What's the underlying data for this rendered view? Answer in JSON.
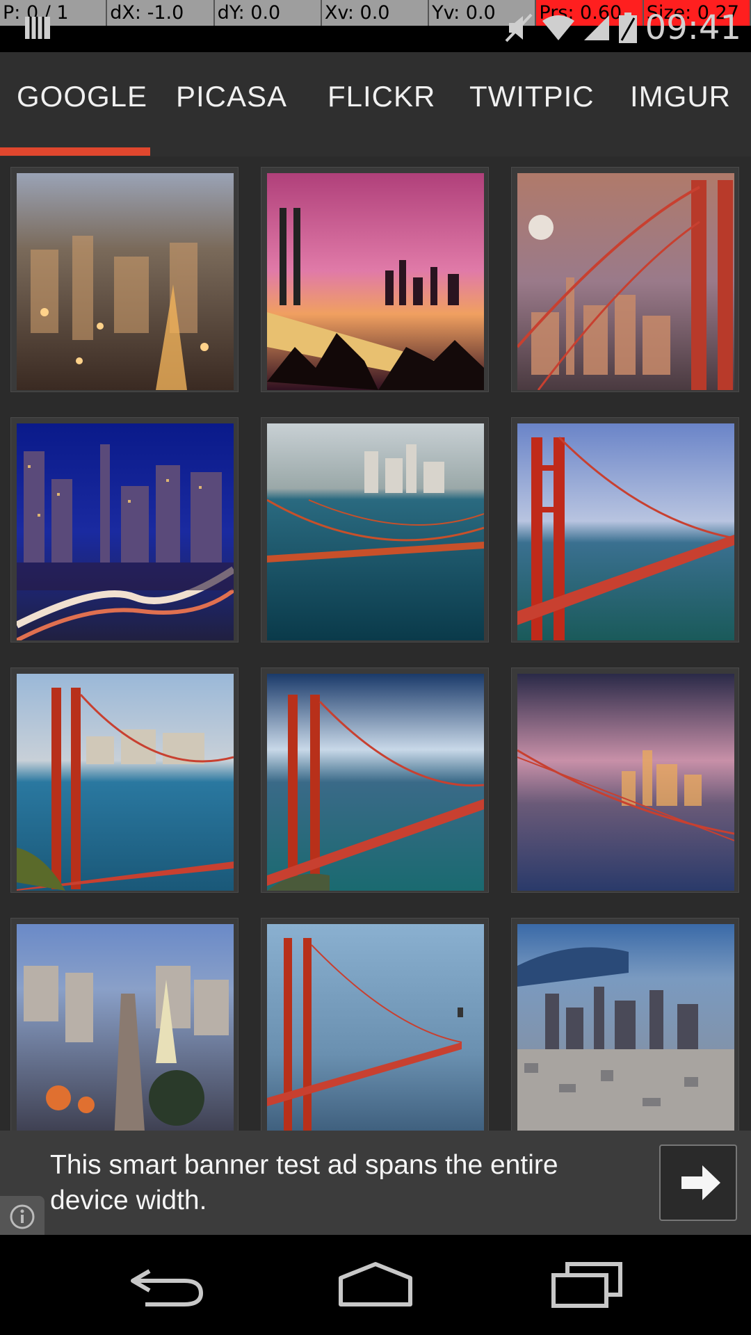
{
  "status": {
    "debug": {
      "p": "P: 0 / 1",
      "dx": "dX: -1.0",
      "dy": "dY: 0.0",
      "xv": "Xv: 0.0",
      "yv": "Yv: 0.0",
      "prs": "Prs: 0.60",
      "size": "Size: 0.27"
    },
    "time": "09:41",
    "icons": [
      "notification-icon",
      "mute-icon",
      "wifi-icon",
      "signal-icon",
      "battery-icon"
    ]
  },
  "tabs": {
    "items": [
      {
        "label": "GOOGLE",
        "selected": true
      },
      {
        "label": "PICASA"
      },
      {
        "label": "FLICKR"
      },
      {
        "label": "TWITPIC"
      },
      {
        "label": "IMGUR"
      }
    ],
    "accent": "#e0472e"
  },
  "grid": {
    "images": [
      "city-night-blur",
      "bay-bridge-sunset",
      "golden-gate-moon",
      "city-night-skyline",
      "bay-bridge-aerial",
      "golden-gate-tower",
      "golden-gate-hill",
      "golden-gate-clouds",
      "golden-gate-dusk",
      "city-street-hills",
      "golden-gate-fog",
      "city-aerial"
    ]
  },
  "ad": {
    "text": "This smart banner test ad spans the entire device width.",
    "icons": [
      "arrow-right-icon",
      "info-icon"
    ]
  },
  "nav": {
    "icons": [
      "back-icon",
      "home-icon",
      "recents-icon"
    ]
  }
}
